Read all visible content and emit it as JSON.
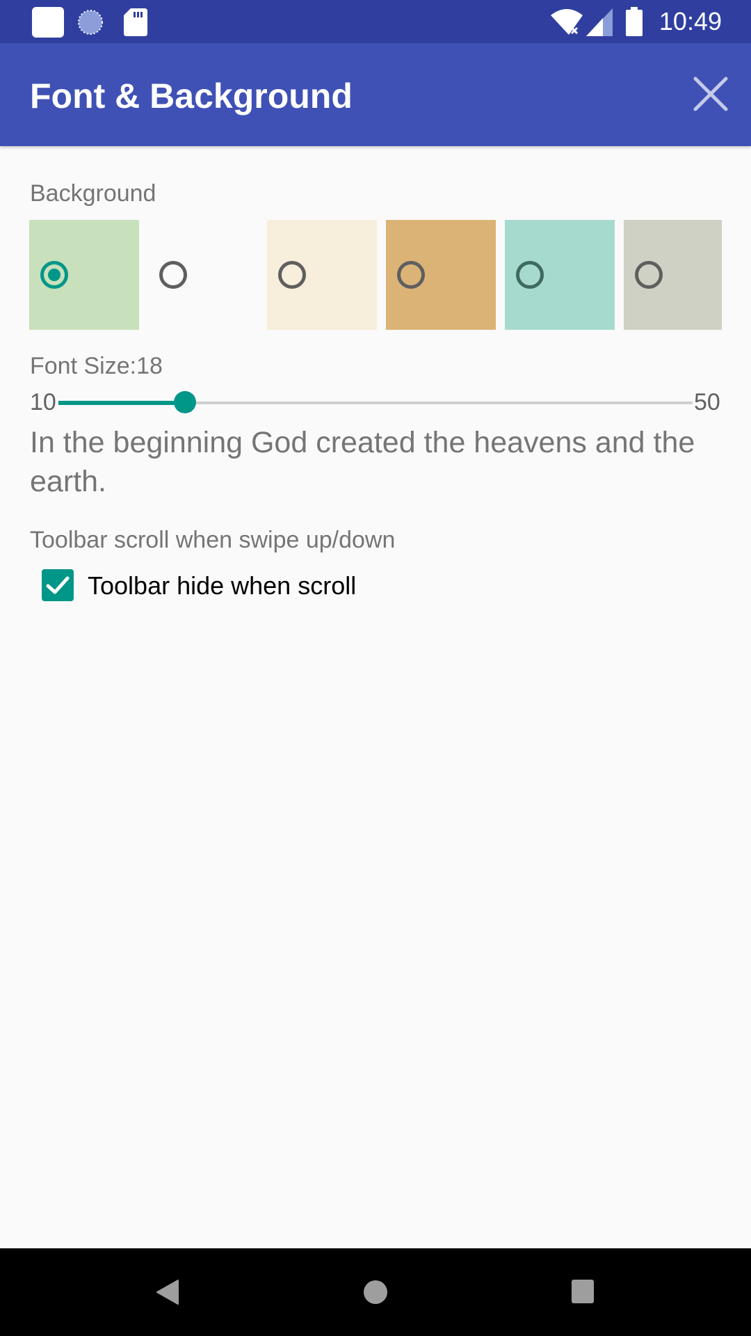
{
  "status_bar": {
    "time": "10:49",
    "icons": [
      "notification-square-icon",
      "sync-icon",
      "sd-card-icon",
      "wifi-no-internet-icon",
      "signal-icon",
      "battery-icon"
    ]
  },
  "app_bar": {
    "title": "Font & Background",
    "close_icon": "close-icon"
  },
  "background": {
    "label": "Background",
    "selected_index": 0,
    "options": [
      {
        "name": "green-paper",
        "color": "#c8e0bc"
      },
      {
        "name": "white",
        "color": "#fafafa"
      },
      {
        "name": "cream-paper",
        "color": "#f7eedb"
      },
      {
        "name": "tan-paper",
        "color": "#dcb377"
      },
      {
        "name": "aqua-paper",
        "color": "#a7dacf"
      },
      {
        "name": "gray-paper",
        "color": "#cfd1c4"
      }
    ]
  },
  "font_size": {
    "label": "Font Size:18",
    "value": 18,
    "min": 10,
    "max": 50,
    "min_label": "10",
    "max_label": "50",
    "preview_text": "In the beginning God created the heavens and the earth."
  },
  "toolbar": {
    "label": "Toolbar scroll when swipe up/down",
    "checkbox_label": "Toolbar hide when scroll",
    "checked": true
  },
  "colors": {
    "status_bar": "#303f9f",
    "app_bar": "#3f51b5",
    "accent": "#009688"
  },
  "nav_bar": {
    "buttons": [
      "back-icon",
      "home-icon",
      "recents-icon"
    ]
  }
}
